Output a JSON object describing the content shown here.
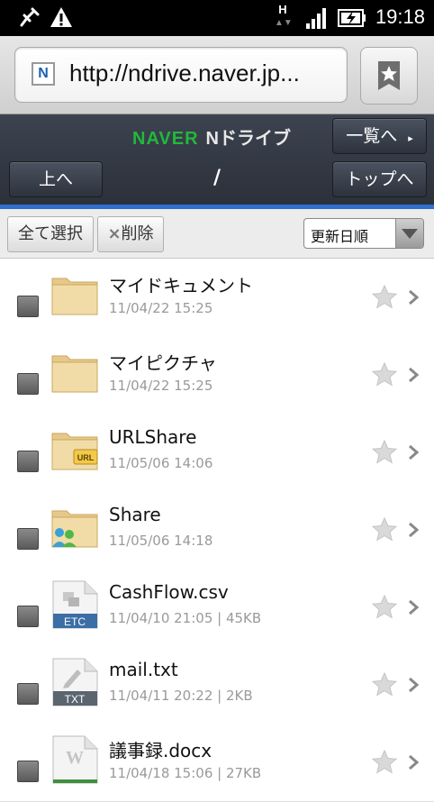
{
  "status_bar": {
    "time": "19:18",
    "icons": [
      "usb-debug-icon",
      "warning-icon",
      "hspa-data-icon",
      "signal-icon",
      "battery-charging-icon"
    ],
    "network_label": "H"
  },
  "browser": {
    "url": "http://ndrive.naver.jp...",
    "favicon_letter": "N"
  },
  "header": {
    "brand": "NAVER",
    "product": "Nドライブ",
    "list_button": "一覧へ",
    "up_button": "上へ",
    "path": "/",
    "top_button": "トップへ"
  },
  "toolbar": {
    "select_all": "全て選択",
    "delete": "削除",
    "delete_mark": "×",
    "sort_value": "更新日順"
  },
  "files": [
    {
      "name": "マイドキュメント",
      "meta": "11/04/22 15:25",
      "type": "folder"
    },
    {
      "name": "マイピクチャ",
      "meta": "11/04/22 15:25",
      "type": "folder"
    },
    {
      "name": "URLShare",
      "meta": "11/05/06 14:06",
      "type": "folder-url",
      "badge": "URL"
    },
    {
      "name": "Share",
      "meta": "11/05/06 14:18",
      "type": "folder-share"
    },
    {
      "name": "CashFlow.csv",
      "meta": "11/04/10 21:05 | 45KB",
      "type": "file",
      "badge": "ETC",
      "badge_color": "#3a6ea5"
    },
    {
      "name": "mail.txt",
      "meta": "11/04/11 20:22 | 2KB",
      "type": "file",
      "badge": "TXT",
      "badge_color": "#5b6570"
    },
    {
      "name": "議事録.docx",
      "meta": "11/04/18 15:06 | 27KB",
      "type": "file-word",
      "badge": "W",
      "badge_color": "#3f8f3f"
    }
  ],
  "colors": {
    "accent_blue": "#2f6fd0",
    "naver_green": "#22b83a",
    "header_bg": "#2b3039"
  }
}
